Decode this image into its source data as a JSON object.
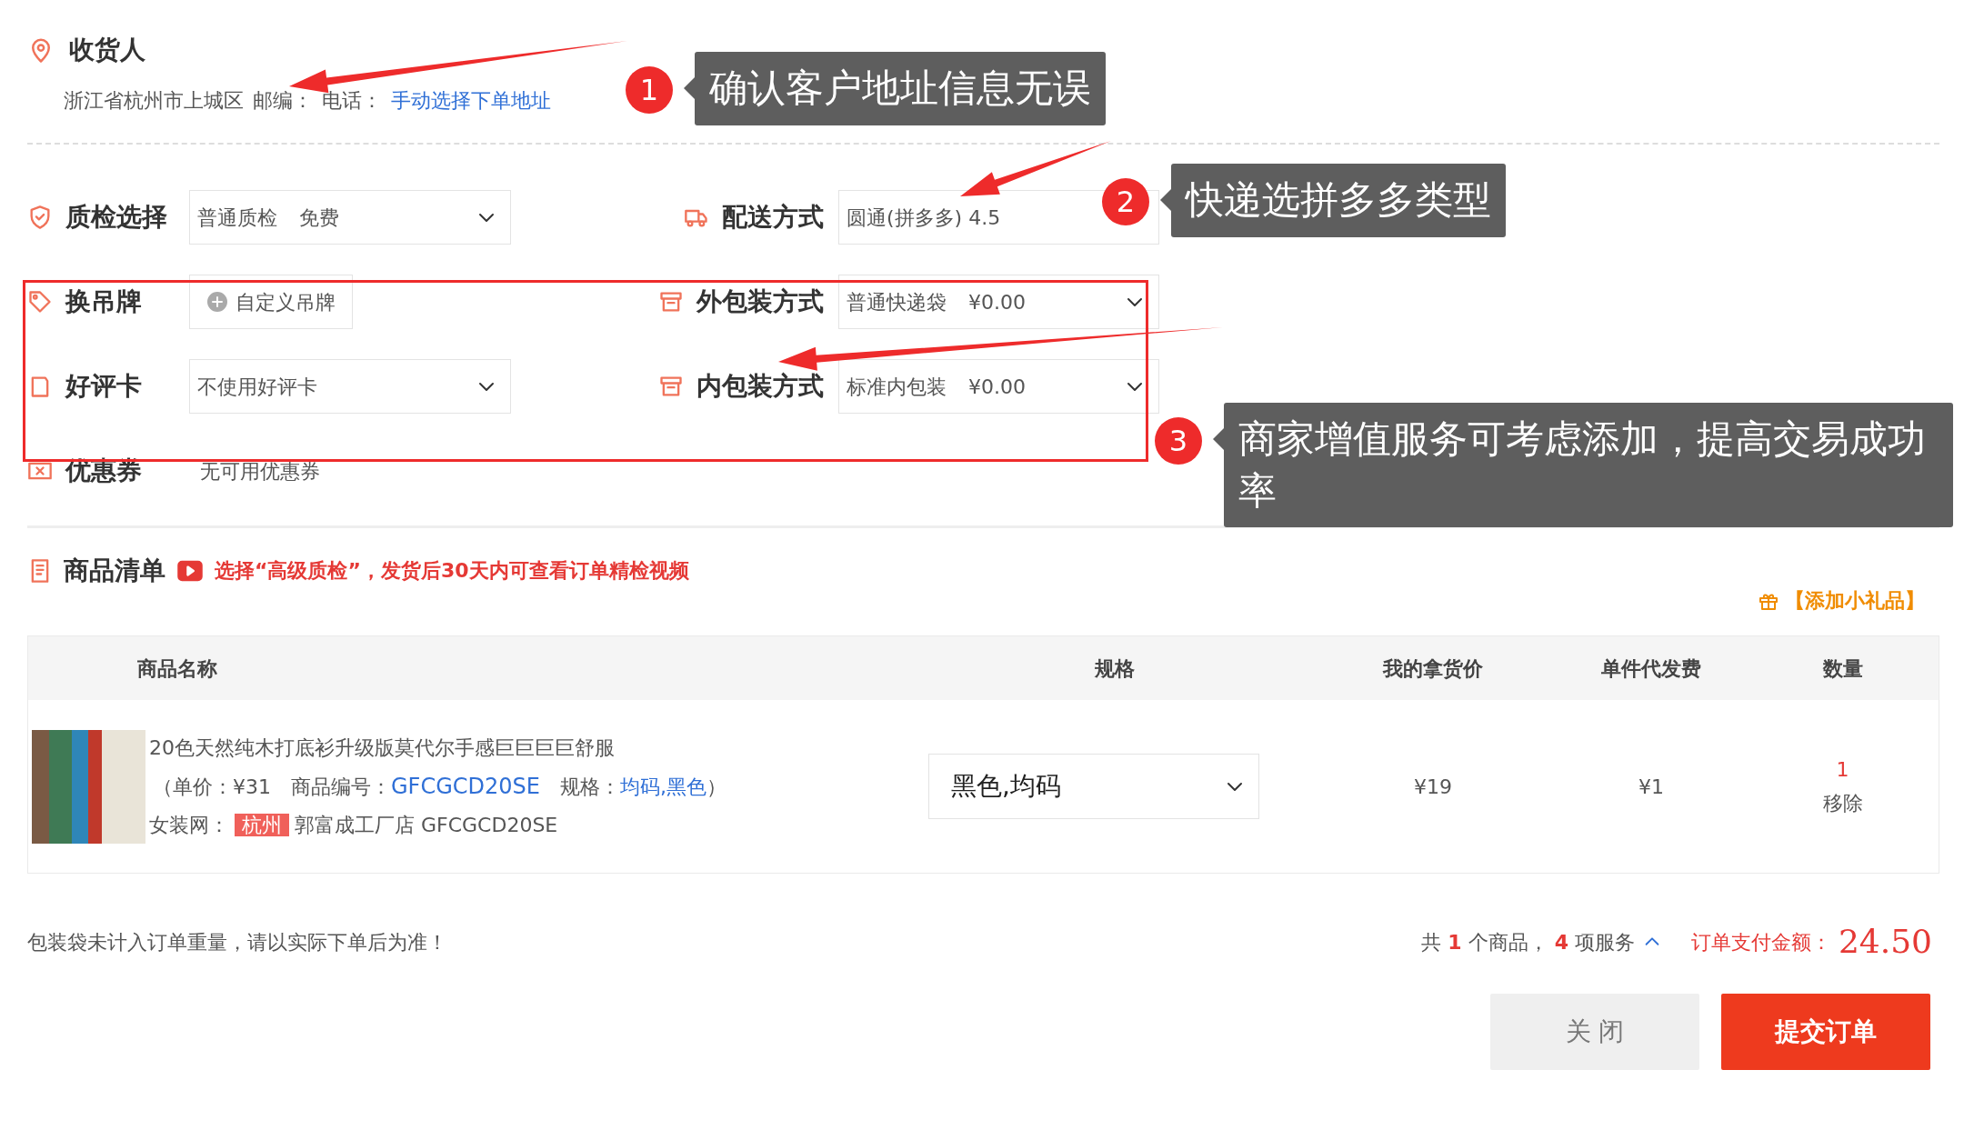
{
  "receiver": {
    "title": "收货人",
    "address": "浙江省杭州市上城区",
    "postcode_label": "邮编：",
    "phone_label": "电话：",
    "link": "手动选择下单地址"
  },
  "option_rows": [
    {
      "left": {
        "label": "质检选择",
        "kind": "select",
        "value": "普通质检",
        "note": "免费"
      },
      "right": {
        "label": "配送方式",
        "kind": "select",
        "value": "圆通(拼多多) 4.5"
      }
    },
    {
      "left": {
        "label": "换吊牌",
        "kind": "button",
        "value": "自定义吊牌"
      },
      "right": {
        "label": "外包装方式",
        "kind": "select",
        "value": "普通快递袋",
        "note": "¥0.00"
      }
    },
    {
      "left": {
        "label": "好评卡",
        "kind": "select",
        "value": "不使用好评卡"
      },
      "right": {
        "label": "内包装方式",
        "kind": "select",
        "value": "标准内包装",
        "note": "¥0.00"
      }
    },
    {
      "left": {
        "label": "优惠券",
        "kind": "text",
        "value": "无可用优惠券"
      }
    }
  ],
  "goods": {
    "title": "商品清单",
    "notice": "选择“高级质检”，发货后30天内可查看订单精检视频",
    "gift_link": "【添加小礼品】",
    "columns": [
      "商品名称",
      "规格",
      "我的拿货价",
      "单件代发费",
      "数量"
    ],
    "rows": [
      {
        "name": "20色天然纯木打底衫升级版莫代尔手感巨巨巨巨舒服",
        "unit_price_label": "（单价：",
        "unit_price": "¥31",
        "code_label": "商品编号：",
        "code": "GFCGCD20SE",
        "spec_label": "规格：",
        "spec": "均码,黑色",
        "close": "）",
        "shop_label": "女装网：",
        "city": "杭州",
        "shop": "郭富成工厂店 GFCGCD20SE",
        "spec_select": "黑色,均码",
        "price": "¥19",
        "fee": "¥1",
        "quantity": "1",
        "remove": "移除"
      }
    ]
  },
  "footer": {
    "note": "包装袋未计入订单重量，请以实际下单后为准！",
    "summary": {
      "prefix": "共",
      "items": "1",
      "items_unit": "个商品，",
      "services": "4",
      "services_unit": "项服务"
    },
    "total_label": "订单支付金额：",
    "total": "24.50",
    "buttons": [
      {
        "label": "关 闭",
        "kind": "secondary"
      },
      {
        "label": "提交订单",
        "kind": "primary"
      }
    ]
  },
  "annotations": [
    {
      "number": "1",
      "text": "确认客户地址信息无误"
    },
    {
      "number": "2",
      "text": "快递选拼多多类型"
    },
    {
      "number": "3",
      "text": "商家增值服务可考虑添加，提高交易成功率"
    }
  ]
}
